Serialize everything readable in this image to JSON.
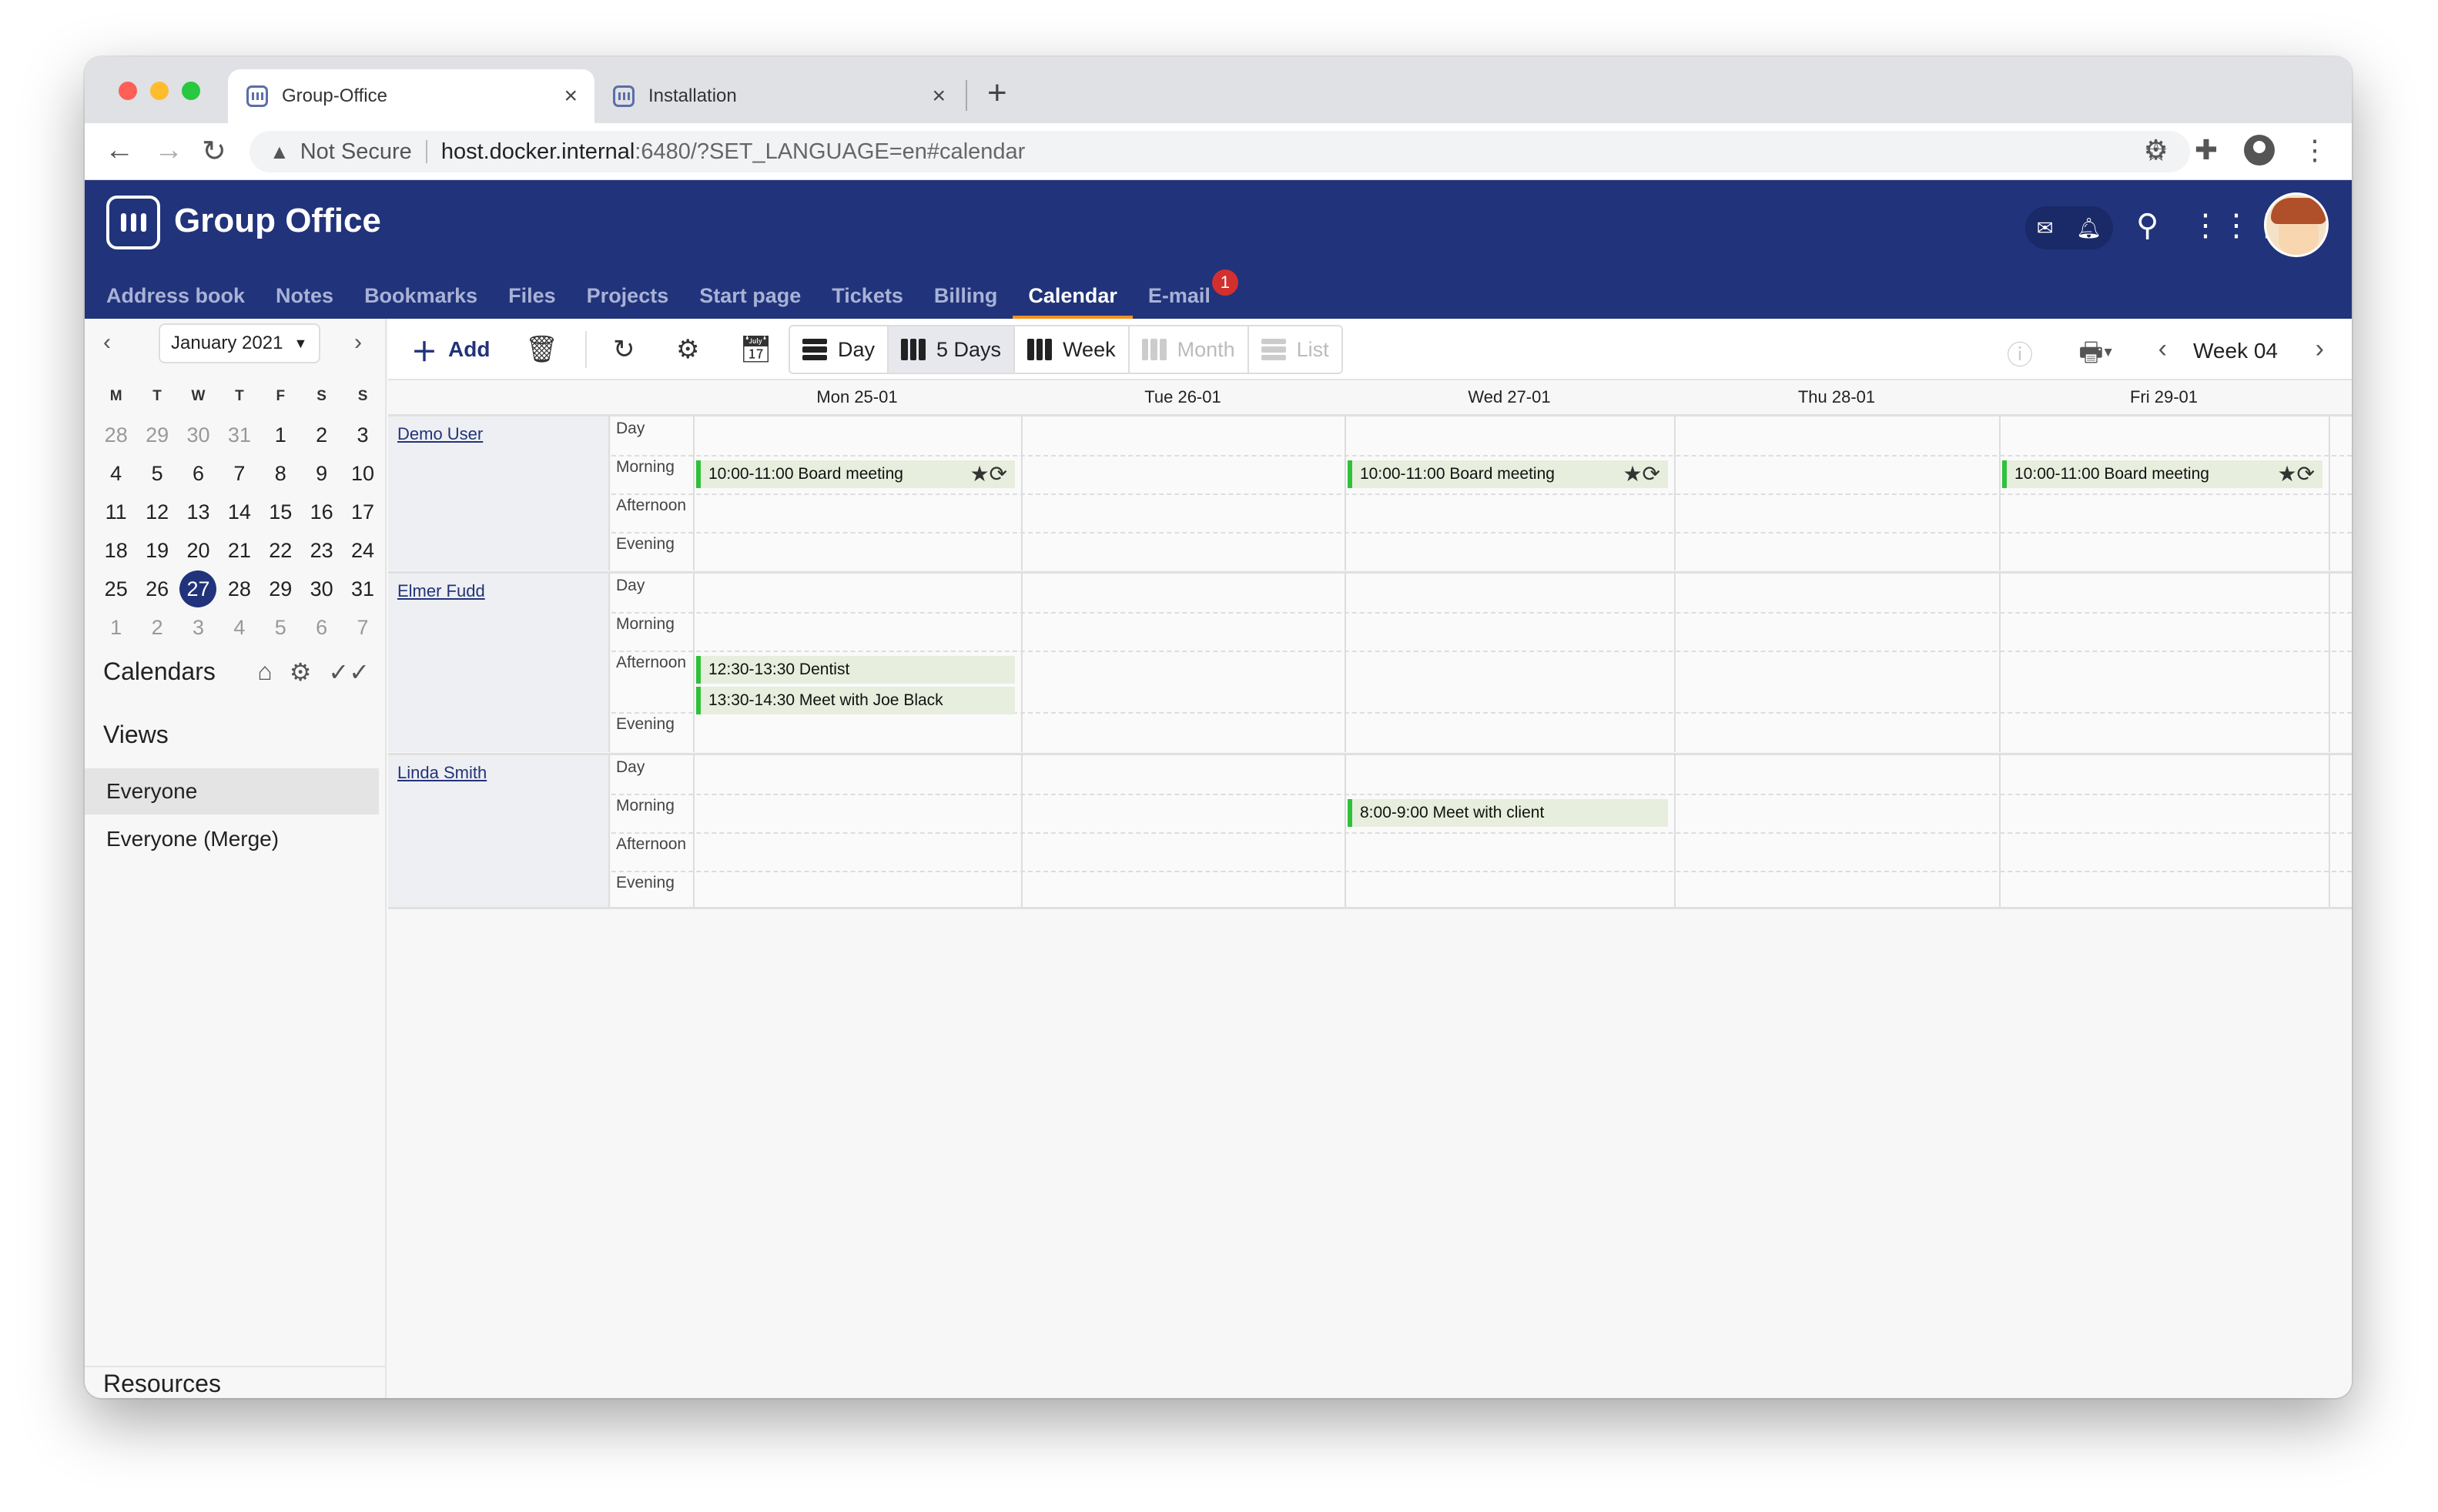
{
  "browser": {
    "tabs": [
      {
        "title": "Group-Office",
        "active": true
      },
      {
        "title": "Installation",
        "active": false
      }
    ],
    "not_secure": "Not Secure",
    "url_host": "host.docker.internal",
    "url_rest": ":6480/?SET_LANGUAGE=en#calendar"
  },
  "app": {
    "name": "Group Office",
    "nav": [
      "Address book",
      "Notes",
      "Bookmarks",
      "Files",
      "Projects",
      "Start page",
      "Tickets",
      "Billing",
      "Calendar",
      "E-mail"
    ],
    "active_nav": "Calendar",
    "email_badge": "1"
  },
  "sidebar": {
    "month_label": "January 2021",
    "dow": [
      "M",
      "T",
      "W",
      "T",
      "F",
      "S",
      "S"
    ],
    "weeks": [
      [
        "28",
        "29",
        "30",
        "31",
        "1",
        "2",
        "3"
      ],
      [
        "4",
        "5",
        "6",
        "7",
        "8",
        "9",
        "10"
      ],
      [
        "11",
        "12",
        "13",
        "14",
        "15",
        "16",
        "17"
      ],
      [
        "18",
        "19",
        "20",
        "21",
        "22",
        "23",
        "24"
      ],
      [
        "25",
        "26",
        "27",
        "28",
        "29",
        "30",
        "31"
      ],
      [
        "1",
        "2",
        "3",
        "4",
        "5",
        "6",
        "7"
      ]
    ],
    "today": "27",
    "calendars_title": "Calendars",
    "views_title": "Views",
    "views": [
      "Everyone",
      "Everyone (Merge)"
    ],
    "selected_view": "Everyone",
    "resources_title": "Resources"
  },
  "toolbar": {
    "add_label": "Add",
    "views": [
      "Day",
      "5 Days",
      "Week",
      "Month",
      "List"
    ],
    "selected_view": "5 Days",
    "week_label": "Week 04"
  },
  "grid": {
    "days": [
      "Mon 25-01",
      "Tue 26-01",
      "Wed 27-01",
      "Thu 28-01",
      "Fri 29-01"
    ],
    "slots": [
      "Day",
      "Morning",
      "Afternoon",
      "Evening"
    ],
    "people": [
      "Demo User",
      "Elmer Fudd",
      "Linda Smith"
    ],
    "events": [
      {
        "person": "Demo User",
        "day": "Mon 25-01",
        "slot": "Morning",
        "text": "10:00-11:00 Board meeting",
        "icons": "★⟳"
      },
      {
        "person": "Demo User",
        "day": "Wed 27-01",
        "slot": "Morning",
        "text": "10:00-11:00 Board meeting",
        "icons": "★⟳"
      },
      {
        "person": "Demo User",
        "day": "Fri 29-01",
        "slot": "Morning",
        "text": "10:00-11:00 Board meeting",
        "icons": "★⟳"
      },
      {
        "person": "Elmer Fudd",
        "day": "Mon 25-01",
        "slot": "Afternoon",
        "text": "12:30-13:30 Dentist",
        "icons": ""
      },
      {
        "person": "Elmer Fudd",
        "day": "Mon 25-01",
        "slot": "Afternoon",
        "text": "13:30-14:30 Meet with Joe Black",
        "icons": ""
      },
      {
        "person": "Linda Smith",
        "day": "Wed 27-01",
        "slot": "Morning",
        "text": "8:00-9:00 Meet with client",
        "icons": ""
      }
    ]
  },
  "colors": {
    "header": "#21337a",
    "accent": "#f39020",
    "event_bar": "#2fc13a",
    "event_bg": "#e8eedd"
  }
}
